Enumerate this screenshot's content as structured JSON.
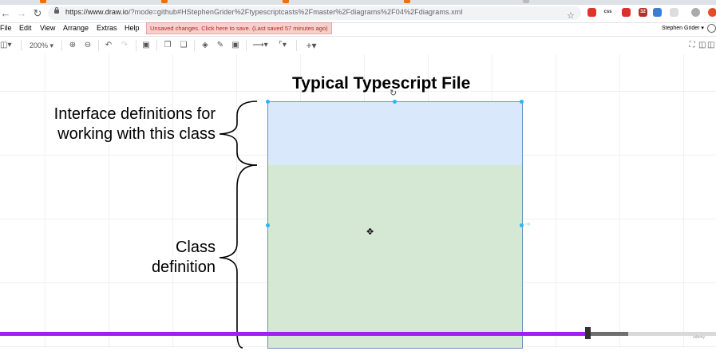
{
  "browser": {
    "url_host": "https://www.draw.io",
    "url_path": "/?mode=github#HStephenGrider%2Ftypescriptcasts%2Fmaster%2Fdiagrams%2F04%2Fdiagrams.xml",
    "extensions": [
      {
        "icon": "opera-icon",
        "color": "#e0342b",
        "text": ""
      },
      {
        "icon": "css-icon",
        "color": "#ffffff",
        "text": "css"
      },
      {
        "icon": "video-icon",
        "color": "#d9322c",
        "text": ""
      },
      {
        "icon": "badge-icon",
        "color": "#b3312b",
        "text": "32"
      },
      {
        "icon": "feather-icon",
        "color": "#3b7fd4",
        "text": ""
      },
      {
        "icon": "blank-icon",
        "color": "#dddddd",
        "text": ""
      },
      {
        "icon": "profile-icon",
        "color": "#aaaaaa",
        "text": ""
      },
      {
        "icon": "alert-icon",
        "color": "#e34c26",
        "text": ""
      }
    ]
  },
  "menu": {
    "items": [
      "File",
      "Edit",
      "View",
      "Arrange",
      "Extras",
      "Help"
    ],
    "unsaved_notice": "Unsaved changes. Click here to save. (Last saved 57 minutes ago)",
    "user_name": "Stephen Grider"
  },
  "toolbar": {
    "zoom": "200%"
  },
  "diagram": {
    "title": "Typical Typescript File",
    "interface_label": "Interface definitions for working with this class",
    "class_label_line1": "Class",
    "class_label_line2": "definition",
    "colors": {
      "interface_fill": "#dae8fc",
      "class_fill": "#d5e8d4",
      "stroke": "#6c8ebf"
    }
  },
  "video": {
    "played_fraction": 0.82,
    "buffered_fraction": 0.877,
    "played_color": "#a020f0",
    "watermark": "udemy"
  }
}
